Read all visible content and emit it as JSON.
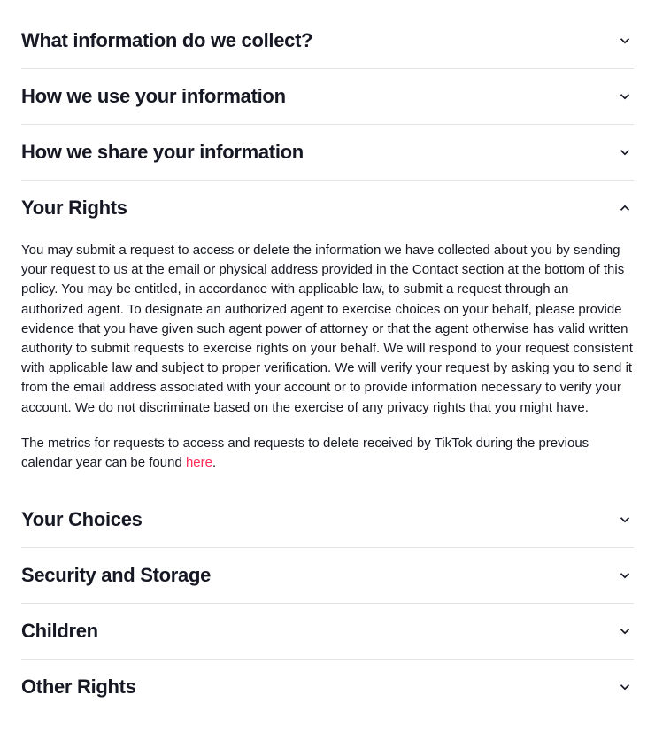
{
  "sections": [
    {
      "title": "What information do we collect?",
      "expanded": false
    },
    {
      "title": "How we use your information",
      "expanded": false
    },
    {
      "title": "How we share your information",
      "expanded": false
    },
    {
      "title": "Your Rights",
      "expanded": true,
      "body": {
        "p1": "You may submit a request to access or delete the information we have collected about you by sending your request to us at the email or physical address provided in the Contact section at the bottom of this policy. You may be entitled, in accordance with applicable law, to submit a request through an authorized agent. To designate an authorized agent to exercise choices on your behalf, please provide evidence that you have given such agent power of attorney or that the agent otherwise has valid written authority to submit requests to exercise rights on your behalf. We will respond to your request consistent with applicable law and subject to proper verification. We will verify your request by asking you to send it from the email address associated with your account or to provide information necessary to verify your account. We do not discriminate based on the exercise of any privacy rights that you might have.",
        "p2a": "The metrics for requests to access and requests to delete received by TikTok during the previous calendar year can be found ",
        "p2link": "here",
        "p2b": "."
      }
    },
    {
      "title": "Your Choices",
      "expanded": false
    },
    {
      "title": "Security and Storage",
      "expanded": false
    },
    {
      "title": "Children",
      "expanded": false
    },
    {
      "title": "Other Rights",
      "expanded": false
    }
  ]
}
